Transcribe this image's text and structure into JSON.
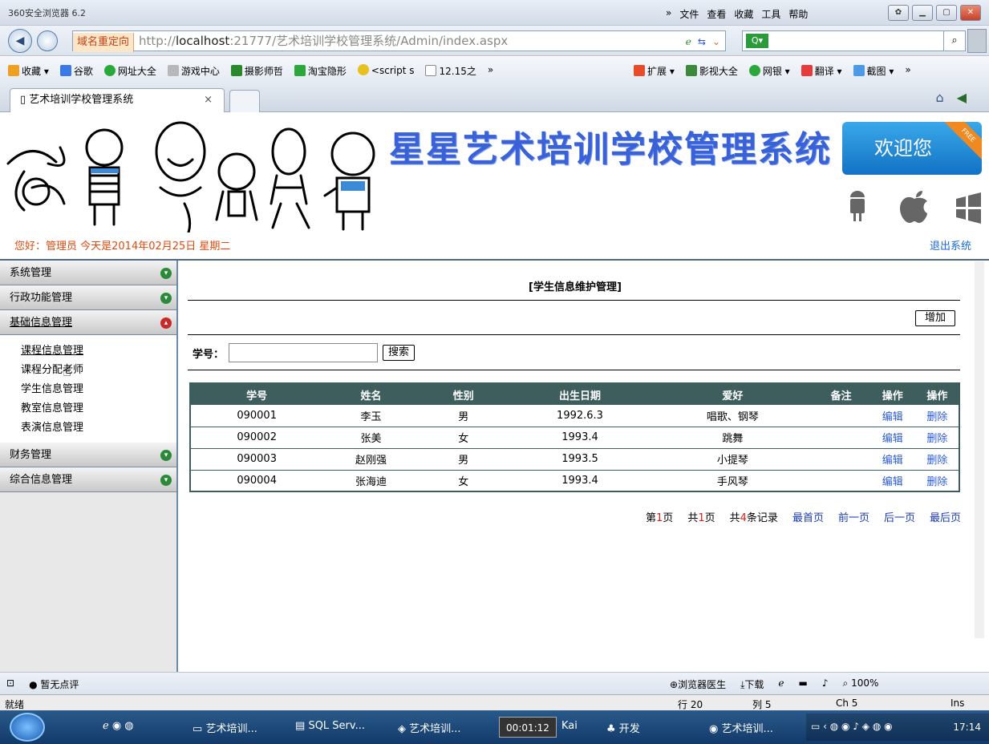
{
  "browser": {
    "app_title": "360安全浏览器 6.2",
    "menus": [
      "»",
      "文件",
      "查看",
      "收藏",
      "工具",
      "帮助"
    ],
    "redirect_label": "域名重定向",
    "url_prefix": "http://",
    "url_host": "localhost",
    "url_rest": ":21777/艺术培训学校管理系统/Admin/index.aspx",
    "favorites_left": [
      "收藏 ▾",
      "谷歌",
      "网址大全",
      "游戏中心",
      "摄影师哲",
      "淘宝隐形",
      "<script s",
      "12.15之",
      "»"
    ],
    "favorites_right": [
      "扩展 ▾",
      "影视大全",
      "网银 ▾",
      "翻译 ▾",
      "截图 ▾",
      "»"
    ],
    "tab_title": "艺术培训学校管理系统",
    "tab_close": "×"
  },
  "header": {
    "site_title": "星星艺术培训学校管理系统",
    "welcome": "欢迎您",
    "ribbon": "FREE",
    "greeting": "您好：管理员 今天是2014年02月25日 星期二",
    "logout": "退出系统"
  },
  "sidebar": {
    "groups": [
      {
        "label": "系统管理",
        "expanded": false
      },
      {
        "label": "行政功能管理",
        "expanded": false
      },
      {
        "label": "基础信息管理",
        "expanded": true
      },
      {
        "label": "财务管理",
        "expanded": false
      },
      {
        "label": "综合信息管理",
        "expanded": false
      }
    ],
    "items": [
      "课程信息管理",
      "课程分配老师",
      "学生信息管理",
      "教室信息管理",
      "表演信息管理"
    ]
  },
  "main": {
    "title": "[学生信息维护管理]",
    "add_label": "增加",
    "search_label": "学号：",
    "search_value": "",
    "search_button": "搜索",
    "columns": [
      "学号",
      "姓名",
      "性别",
      "出生日期",
      "爱好",
      "备注",
      "操作",
      "操作"
    ],
    "rows": [
      {
        "id": "090001",
        "name": "李玉",
        "gender": "男",
        "birth": "1992.6.3",
        "hobby": "唱歌、钢琴",
        "note": "",
        "edit": "编辑",
        "del": "删除"
      },
      {
        "id": "090002",
        "name": "张美",
        "gender": "女",
        "birth": "1993.4",
        "hobby": "跳舞",
        "note": "",
        "edit": "编辑",
        "del": "删除"
      },
      {
        "id": "090003",
        "name": "赵刚强",
        "gender": "男",
        "birth": "1993.5",
        "hobby": "小提琴",
        "note": "",
        "edit": "编辑",
        "del": "删除"
      },
      {
        "id": "090004",
        "name": "张海迪",
        "gender": "女",
        "birth": "1993.4",
        "hobby": "手风琴",
        "note": "",
        "edit": "编辑",
        "del": "删除"
      }
    ],
    "pager": {
      "page_pre": "第",
      "page_num": "1",
      "page_post": "页",
      "total_pre": "共",
      "total_num": "1",
      "total_post": "页",
      "rec_pre": "共",
      "rec_num": "4",
      "rec_post": "条记录",
      "first": "最首页",
      "prev": "前一页",
      "next": "后一页",
      "last": "最后页"
    }
  },
  "bottom_bar": {
    "comment": "暂无点评",
    "doctor": "浏览器医生",
    "download": "下载",
    "zoom": "100%"
  },
  "status": {
    "ready": "就绪",
    "row": "行 20",
    "col": "列 5",
    "ch": "Ch 5",
    "ins": "Ins"
  },
  "taskbar": {
    "items": [
      "艺术培训...",
      "SQL Serv...",
      "艺术培训...",
      "Kai",
      "开发",
      "艺术培训..."
    ],
    "rec_time": "00:01:12",
    "clock": "17:14"
  },
  "colors": {
    "grid_header": "#3e5e5e",
    "link_blue": "#2a5ad8",
    "greeting_orange": "#e04a10",
    "title_blue": "#3a62d8"
  }
}
